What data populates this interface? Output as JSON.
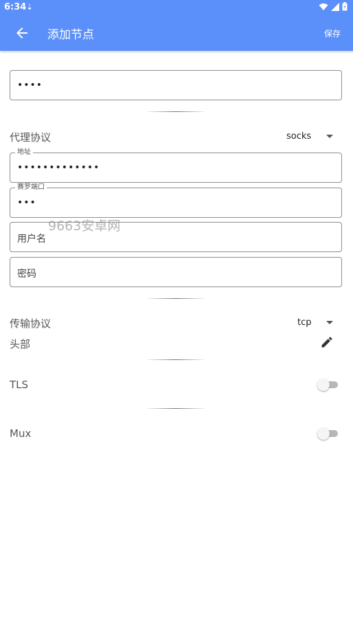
{
  "status_bar": {
    "time": "6:34",
    "notification_icon": "download-notification-icon",
    "wifi_icon": "wifi-icon",
    "signal_icon": "signal-icon",
    "battery_icon": "battery-icon"
  },
  "app_bar": {
    "title": "添加节点",
    "save_label": "保存",
    "back_icon": "arrow-left-icon",
    "color": "#5b8ff9"
  },
  "form": {
    "remarks_value": "••••",
    "proxy_protocol": {
      "label": "代理协议",
      "value": "socks"
    },
    "address": {
      "label": "地址",
      "value": "•••••••••••••"
    },
    "port": {
      "label": "赛罗端口",
      "value": "•••"
    },
    "username": {
      "placeholder": "用户名"
    },
    "password": {
      "placeholder": "密码"
    },
    "transport_protocol": {
      "label": "传输协议",
      "value": "tcp"
    },
    "header": {
      "label": "头部",
      "icon": "pencil-edit-icon"
    },
    "tls": {
      "label": "TLS",
      "enabled": false
    },
    "mux": {
      "label": "Mux",
      "enabled": false
    }
  },
  "watermark": "9663安卓网"
}
